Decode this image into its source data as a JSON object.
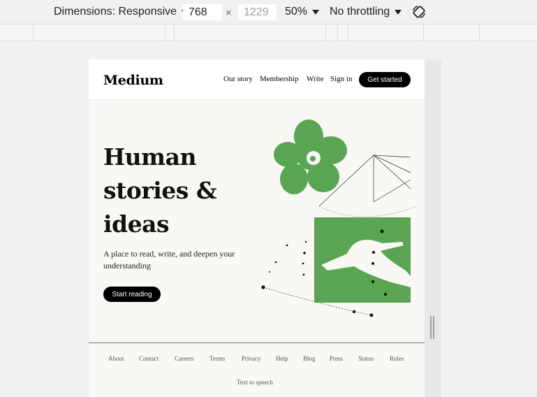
{
  "devtools": {
    "dimensions_label": "Dimensions: Responsive",
    "width_value": "768",
    "height_value": "1229",
    "zoom_label": "50%",
    "throttling_label": "No throttling",
    "icons": [
      "chevron-down-icon",
      "rotate-icon"
    ]
  },
  "site": {
    "logo": "Medium",
    "nav": [
      "Our story",
      "Membership",
      "Write",
      "Sign in"
    ],
    "cta": "Get started"
  },
  "hero": {
    "title_lines": [
      "Human",
      "stories &",
      "ideas"
    ],
    "subtitle": "A place to read, write, and deepen your understanding",
    "button": "Start reading"
  },
  "footer": {
    "links": [
      "About",
      "Contact",
      "Careers",
      "Terms",
      "Privacy",
      "Help",
      "Blog",
      "Press",
      "Status",
      "Rules"
    ],
    "text_to_speech": "Text to speech"
  },
  "colors": {
    "accent_green": "#5aa552",
    "page_bg": "#f9f8f4",
    "button_black": "#000000"
  }
}
